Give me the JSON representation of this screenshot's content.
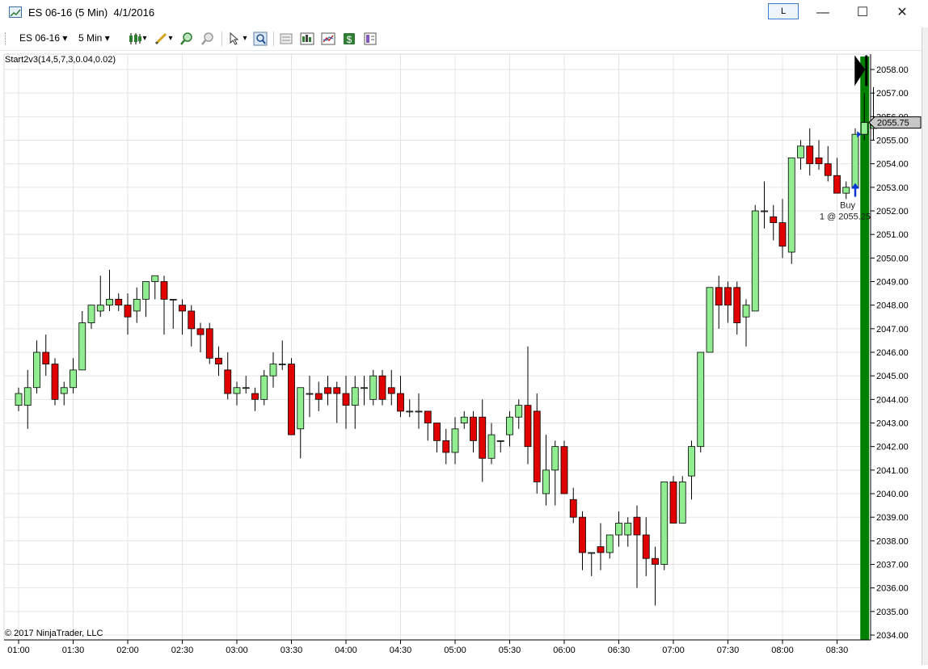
{
  "window": {
    "title": "ES 06-16 (5 Min)  4/1/2016",
    "lock_label": "L",
    "minimize_glyph": "—",
    "maximize_glyph": "☐",
    "close_glyph": "✕"
  },
  "toolbar": {
    "instrument": "ES 06-16",
    "interval": "5 Min",
    "dropdown_glyph": "▾",
    "icons": [
      "candlestick-style-icon",
      "drawing-tool-icon",
      "zoom-in-icon",
      "zoom-out-icon",
      "pointer-icon",
      "magnifier-icon",
      "properties-icon",
      "indicators-icon",
      "strategies-icon",
      "dollar-icon",
      "data-box-icon"
    ]
  },
  "chart": {
    "indicator_label": "Start2v3(14,5,7,3,0.04,0.02)",
    "copyright": "© 2017 NinjaTrader, LLC",
    "current_price_label": "2055.75",
    "buy_label": "Buy",
    "buy_detail": "1 @ 2055.25",
    "colors": {
      "up": "#90ee90",
      "down": "#e00000",
      "grid": "#e4e4e4",
      "strategy_bar": "#008000",
      "arrow": "#0b36d6"
    }
  },
  "chart_data": {
    "type": "candlestick",
    "title": "",
    "y_range": [
      2034,
      2058
    ],
    "y_ticks": [
      "2058.00",
      "2057.00",
      "2056.00",
      "2055.00",
      "2054.00",
      "2053.00",
      "2052.00",
      "2051.00",
      "2050.00",
      "2049.00",
      "2048.00",
      "2047.00",
      "2046.00",
      "2045.00",
      "2044.00",
      "2043.00",
      "2042.00",
      "2041.00",
      "2040.00",
      "2039.00",
      "2038.00",
      "2037.00",
      "2036.00",
      "2035.00",
      "2034.00"
    ],
    "x_ticks": [
      "01:00",
      "01:30",
      "02:00",
      "02:30",
      "03:00",
      "03:30",
      "04:00",
      "04:30",
      "05:00",
      "05:30",
      "06:00",
      "06:30",
      "07:00",
      "07:30",
      "08:00",
      "08:30"
    ],
    "ohlc": [
      [
        2043.75,
        2044.5,
        2043.5,
        2044.25
      ],
      [
        2043.75,
        2045.25,
        2042.75,
        2044.5
      ],
      [
        2044.5,
        2046.5,
        2044.25,
        2046.0
      ],
      [
        2046.0,
        2046.75,
        2045.0,
        2045.5
      ],
      [
        2045.5,
        2045.75,
        2043.75,
        2044.0
      ],
      [
        2044.25,
        2044.75,
        2043.75,
        2044.5
      ],
      [
        2044.5,
        2045.75,
        2044.25,
        2045.25
      ],
      [
        2045.25,
        2047.75,
        2045.25,
        2047.25
      ],
      [
        2047.25,
        2048.0,
        2047.0,
        2048.0
      ],
      [
        2047.75,
        2049.25,
        2047.5,
        2048.0
      ],
      [
        2048.0,
        2049.5,
        2047.75,
        2048.25
      ],
      [
        2048.25,
        2048.5,
        2047.75,
        2048.0
      ],
      [
        2048.0,
        2048.5,
        2046.75,
        2047.5
      ],
      [
        2047.75,
        2048.75,
        2047.25,
        2048.25
      ],
      [
        2048.25,
        2049.0,
        2047.5,
        2049.0
      ],
      [
        2049.0,
        2049.25,
        2048.25,
        2049.25
      ],
      [
        2049.0,
        2049.25,
        2046.75,
        2048.25
      ],
      [
        2048.25,
        2048.25,
        2047.0,
        2048.25
      ],
      [
        2048.0,
        2048.25,
        2046.75,
        2047.75
      ],
      [
        2047.75,
        2048.0,
        2046.25,
        2047.0
      ],
      [
        2047.0,
        2047.25,
        2046.0,
        2046.75
      ],
      [
        2047.0,
        2047.25,
        2045.5,
        2045.75
      ],
      [
        2045.75,
        2046.25,
        2045.0,
        2045.5
      ],
      [
        2045.25,
        2046.0,
        2044.0,
        2044.25
      ],
      [
        2044.25,
        2044.75,
        2043.75,
        2044.5
      ],
      [
        2044.5,
        2045.0,
        2044.25,
        2044.5
      ],
      [
        2044.25,
        2044.5,
        2043.5,
        2044.0
      ],
      [
        2044.0,
        2045.25,
        2043.75,
        2045.0
      ],
      [
        2045.0,
        2046.0,
        2044.5,
        2045.5
      ],
      [
        2045.5,
        2046.5,
        2045.25,
        2045.5
      ],
      [
        2045.5,
        2045.75,
        2042.5,
        2042.5
      ],
      [
        2042.75,
        2044.25,
        2041.5,
        2044.5
      ],
      [
        2044.25,
        2045.0,
        2043.25,
        2044.25
      ],
      [
        2044.25,
        2044.75,
        2043.5,
        2044.0
      ],
      [
        2044.5,
        2045.0,
        2043.75,
        2044.25
      ],
      [
        2044.5,
        2044.75,
        2043.0,
        2044.25
      ],
      [
        2044.25,
        2045.0,
        2042.75,
        2043.75
      ],
      [
        2043.75,
        2045.0,
        2042.75,
        2044.5
      ],
      [
        2044.5,
        2045.0,
        2043.75,
        2044.5
      ],
      [
        2044.0,
        2045.25,
        2043.75,
        2045.0
      ],
      [
        2045.0,
        2045.25,
        2043.75,
        2044.0
      ],
      [
        2044.5,
        2045.25,
        2043.75,
        2044.25
      ],
      [
        2044.25,
        2045.0,
        2043.25,
        2043.5
      ],
      [
        2043.5,
        2044.0,
        2043.25,
        2043.5
      ],
      [
        2043.5,
        2044.25,
        2042.75,
        2043.5
      ],
      [
        2043.5,
        2043.5,
        2042.25,
        2043.0
      ],
      [
        2043.0,
        2043.0,
        2041.75,
        2042.25
      ],
      [
        2042.25,
        2042.75,
        2041.25,
        2041.75
      ],
      [
        2041.75,
        2043.25,
        2041.25,
        2042.75
      ],
      [
        2043.0,
        2043.5,
        2042.75,
        2043.25
      ],
      [
        2043.25,
        2043.5,
        2041.75,
        2042.25
      ],
      [
        2043.25,
        2044.0,
        2040.5,
        2041.5
      ],
      [
        2041.5,
        2043.0,
        2041.25,
        2042.5
      ],
      [
        2042.25,
        2042.25,
        2041.75,
        2042.25
      ],
      [
        2042.5,
        2043.5,
        2042.0,
        2043.25
      ],
      [
        2043.25,
        2044.0,
        2042.75,
        2043.75
      ],
      [
        2043.75,
        2046.25,
        2041.25,
        2042.0
      ],
      [
        2043.5,
        2044.25,
        2040.0,
        2040.5
      ],
      [
        2040.0,
        2042.5,
        2039.5,
        2041.0
      ],
      [
        2041.0,
        2042.25,
        2039.5,
        2042.0
      ],
      [
        2042.0,
        2042.25,
        2040.25,
        2040.0
      ],
      [
        2039.75,
        2040.25,
        2038.75,
        2039.0
      ],
      [
        2039.0,
        2039.25,
        2036.75,
        2037.5
      ],
      [
        2037.5,
        2037.5,
        2036.5,
        2037.5
      ],
      [
        2037.75,
        2038.75,
        2036.75,
        2037.5
      ],
      [
        2037.5,
        2038.25,
        2037.25,
        2038.25
      ],
      [
        2038.25,
        2039.25,
        2037.75,
        2038.75
      ],
      [
        2038.25,
        2039.0,
        2037.75,
        2038.75
      ],
      [
        2039.0,
        2039.5,
        2036.0,
        2038.25
      ],
      [
        2038.25,
        2039.0,
        2036.5,
        2037.25
      ],
      [
        2037.25,
        2037.75,
        2035.25,
        2037.0
      ],
      [
        2037.0,
        2040.5,
        2036.75,
        2040.5
      ],
      [
        2040.5,
        2040.75,
        2038.75,
        2038.75
      ],
      [
        2038.75,
        2040.75,
        2038.75,
        2040.5
      ],
      [
        2040.75,
        2042.25,
        2039.75,
        2042.0
      ],
      [
        2042.0,
        2046.0,
        2041.75,
        2046.0
      ],
      [
        2046.0,
        2048.75,
        2046.0,
        2048.75
      ],
      [
        2048.75,
        2049.25,
        2047.0,
        2048.0
      ],
      [
        2048.75,
        2049.0,
        2047.25,
        2048.0
      ],
      [
        2048.75,
        2049.0,
        2046.75,
        2047.25
      ],
      [
        2047.5,
        2048.25,
        2046.25,
        2048.0
      ],
      [
        2047.75,
        2052.25,
        2047.75,
        2052.0
      ],
      [
        2052.0,
        2053.25,
        2051.25,
        2052.0
      ],
      [
        2051.75,
        2052.25,
        2050.75,
        2051.5
      ],
      [
        2051.5,
        2052.5,
        2050.0,
        2050.5
      ],
      [
        2050.25,
        2054.25,
        2049.75,
        2054.25
      ],
      [
        2054.25,
        2055.0,
        2053.75,
        2054.75
      ],
      [
        2054.75,
        2055.5,
        2053.5,
        2054.0
      ],
      [
        2054.25,
        2055.0,
        2053.75,
        2054.0
      ],
      [
        2054.0,
        2054.75,
        2053.25,
        2053.5
      ],
      [
        2053.5,
        2054.25,
        2052.75,
        2052.75
      ],
      [
        2052.75,
        2053.25,
        2052.5,
        2053.0
      ],
      [
        2053.0,
        2055.5,
        2052.75,
        2055.25
      ],
      [
        2055.25,
        2057.0,
        2055.0,
        2055.75
      ],
      [
        2055.5,
        2057.25,
        2055.0,
        2055.75
      ]
    ]
  }
}
